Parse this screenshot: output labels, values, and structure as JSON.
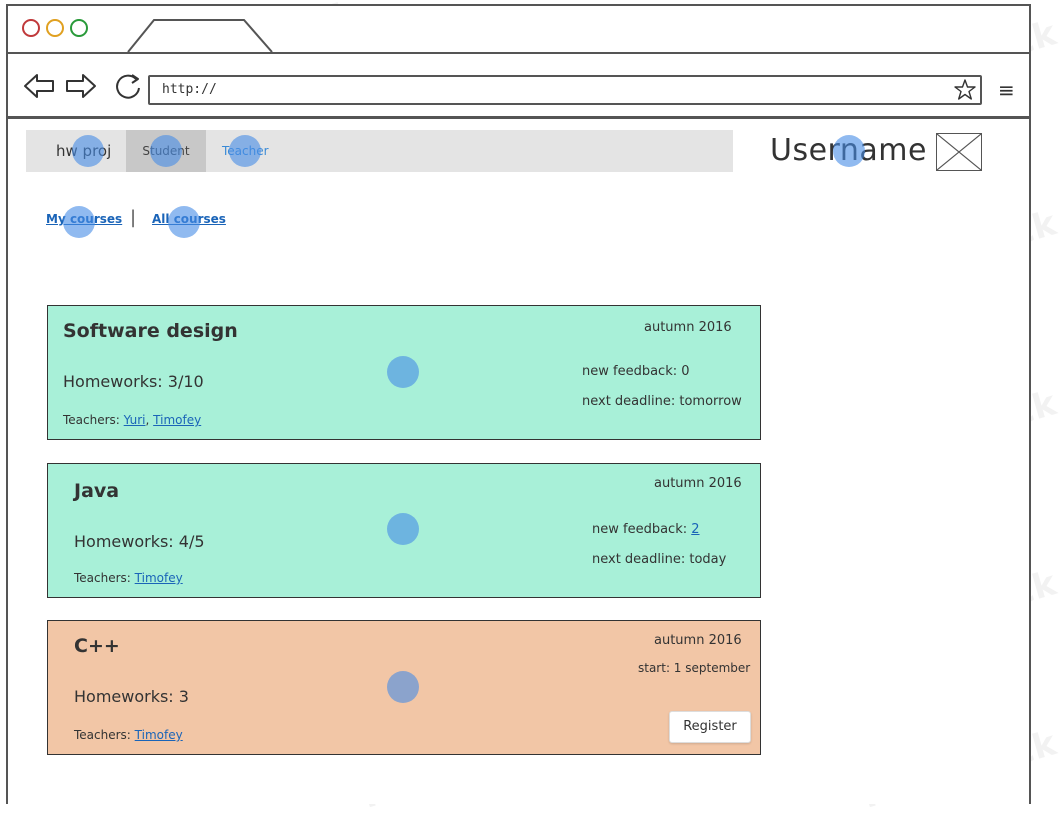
{
  "browser": {
    "url": "http://",
    "dot_colors": [
      "#c0393b",
      "#e0a020",
      "#2a9a3a"
    ]
  },
  "nav": {
    "brand": "hw proj",
    "tabs": [
      {
        "label": "Student",
        "active": true
      },
      {
        "label": "Teacher",
        "active": false
      }
    ]
  },
  "user": {
    "name": "Username"
  },
  "course_links": {
    "my": "My courses",
    "all": "All courses",
    "separator": "|"
  },
  "courses": [
    {
      "title": "Software design",
      "term": "autumn 2016",
      "homeworks": "Homeworks: 3/10",
      "feedback_label": "new feedback: 0",
      "deadline": "next deadline: tomorrow",
      "teachers_label": "Teachers:",
      "teachers": [
        "Yuri",
        "Timofey"
      ],
      "teacher_sep": ",",
      "status": "enrolled",
      "color": "#a8f0d8"
    },
    {
      "title": "Java",
      "term": "autumn 2016",
      "homeworks": "Homeworks: 4/5",
      "feedback_label": "new feedback:",
      "feedback_count": "2",
      "deadline": "next deadline: today",
      "teachers_label": "Teachers:",
      "teachers": [
        "Timofey"
      ],
      "status": "enrolled",
      "color": "#a8f0d8"
    },
    {
      "title": "C++",
      "term": "autumn 2016",
      "start": "start: 1 september",
      "homeworks": "Homeworks: 3",
      "teachers_label": "Teachers:",
      "teachers": [
        "Timofey"
      ],
      "register_label": "Register",
      "status": "available",
      "color": "#f2c6a6"
    }
  ],
  "watermark": "NinjaMock"
}
